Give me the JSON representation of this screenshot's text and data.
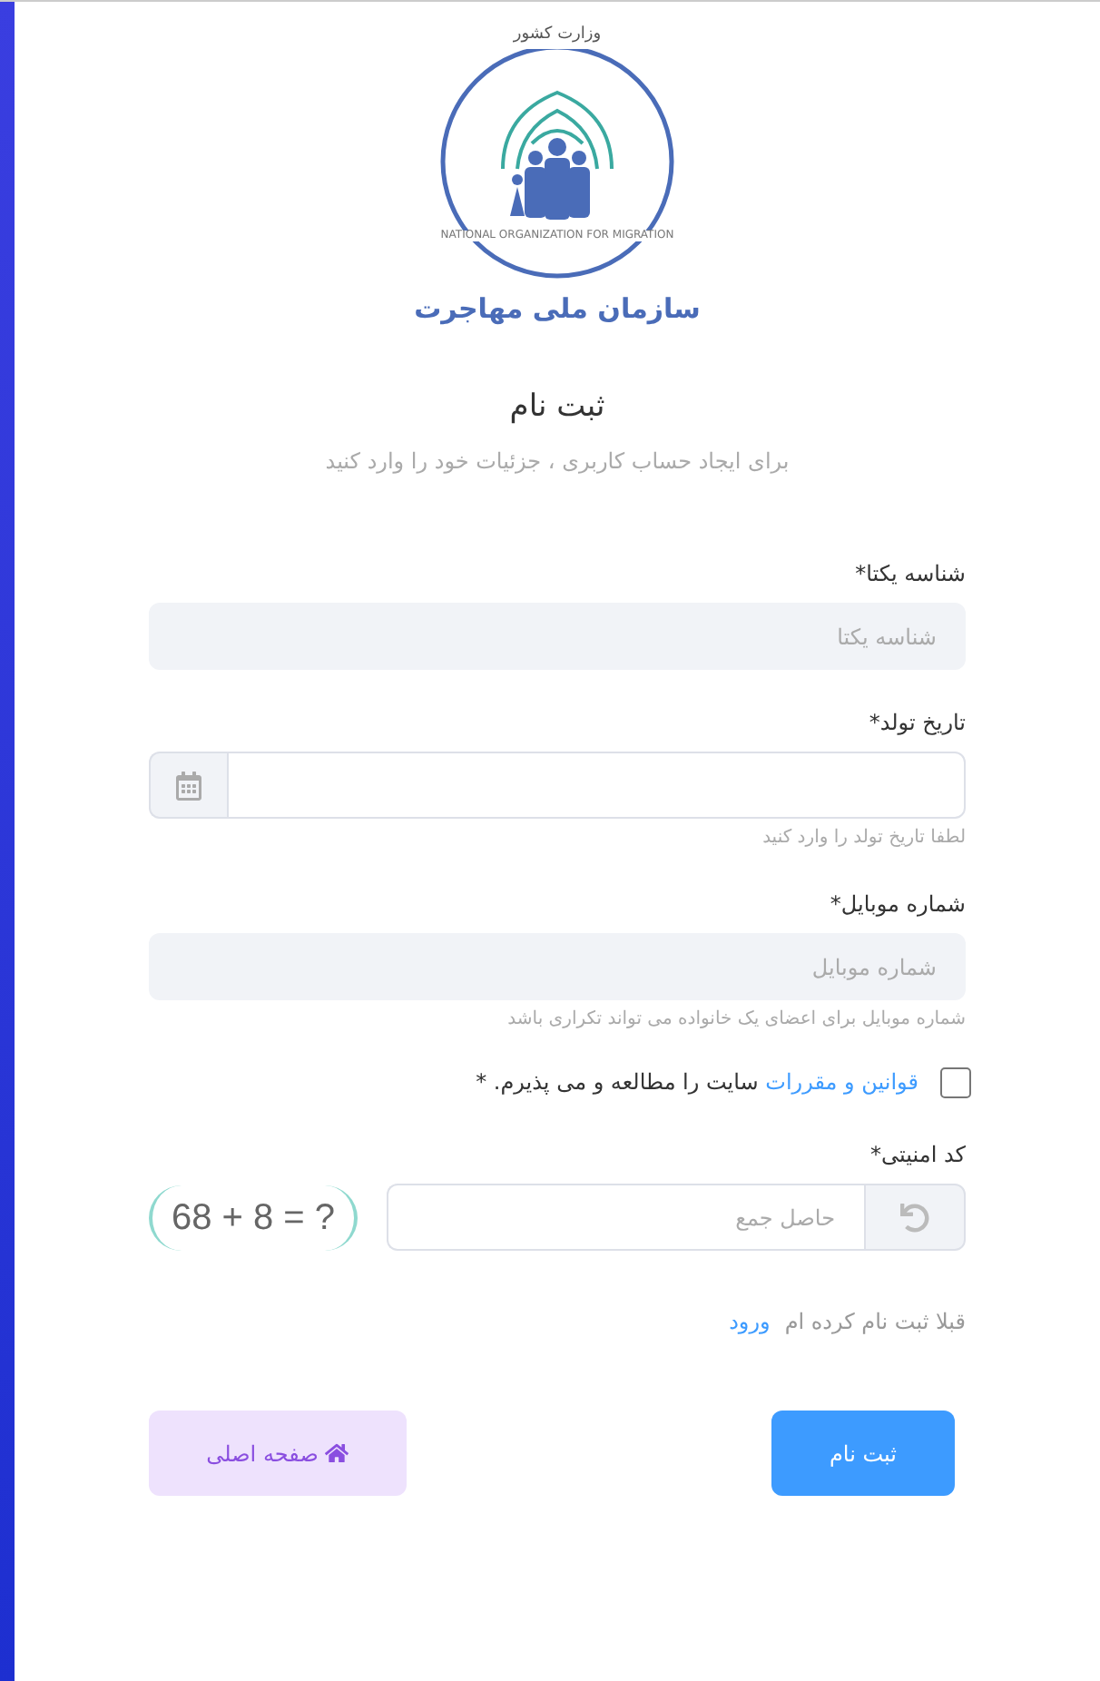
{
  "logo": {
    "top_text": "وزارت کشور",
    "ring_text": "NATIONAL ORGANIZATION FOR MIGRATION",
    "caption": "سازمان ملی مهاجرت"
  },
  "title": "ثبت نام",
  "subtitle": "برای ایجاد حساب کاربری ، جزئیات خود را وارد کنید",
  "fields": [
    {
      "kind": "text",
      "label": "شناسه یکتا*",
      "placeholder": "شناسه یکتا"
    },
    {
      "kind": "date",
      "label": "تاریخ تولد*",
      "hint": "لطفا تاریخ تولد را وارد کنید"
    },
    {
      "kind": "text",
      "label": "شماره موبایل*",
      "placeholder": "شماره موبایل",
      "hint": "شماره موبایل برای اعضای یک خانواده می تواند تکراری باشد"
    }
  ],
  "terms": {
    "checked": false,
    "link": "قوانین و مقررات",
    "text": " سایت را مطالعه و می پذیرم. *"
  },
  "captcha": {
    "label": "کد امنیتی*",
    "placeholder": "حاصل جمع",
    "image_text": "68 + 8 = ?"
  },
  "login": {
    "text": "قبلا ثبت نام کرده ام",
    "link": "ورود"
  },
  "buttons": {
    "submit": "ثبت نام",
    "home": "صفحه اصلی"
  }
}
